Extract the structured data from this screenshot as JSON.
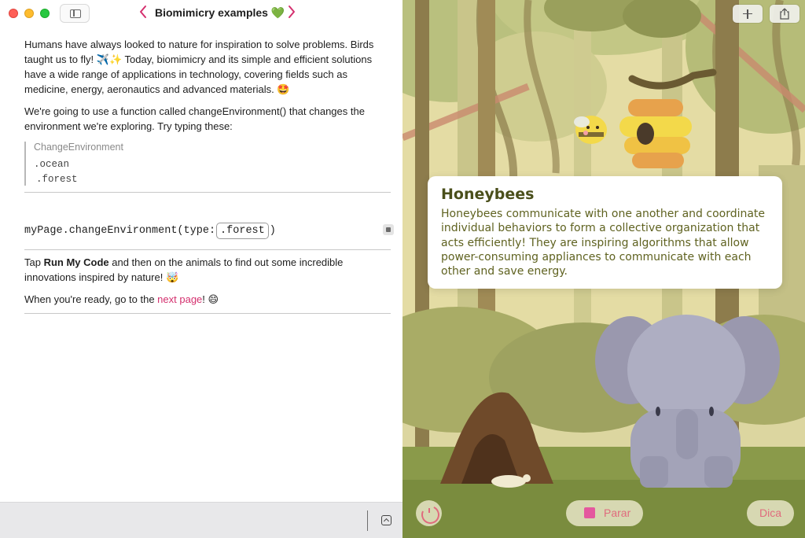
{
  "window": {
    "title": "Biomimicry examples",
    "title_emoji": "💚"
  },
  "left": {
    "paragraph1": {
      "text_a": "Humans have always looked to nature for inspiration to solve problems. Birds taught us to fly! ",
      "emoji_a": "✈️✨",
      "text_b": " Today, biomimicry and its simple and efficient solutions have a wide range of applications in technology, covering fields such as medicine, energy, aeronautics and advanced materials. ",
      "emoji_b": "🤩"
    },
    "paragraph2": "We're going to use a function called changeEnvironment() that changes the environment we're exploring. Try typing these:",
    "quote": {
      "heading": "ChangeEnvironment",
      "option1": ".ocean",
      "option2": ".forest"
    },
    "code": {
      "prefix": "myPage.changeEnvironment(type: ",
      "token": ".forest",
      "suffix": ")"
    },
    "paragraph3": {
      "text_a": "Tap ",
      "bold": "Run My Code",
      "text_b": " and then on the animals to find out some incredible innovations inspired by nature! ",
      "emoji": "🤯"
    },
    "paragraph4": {
      "text_a": "When you're ready, go to the ",
      "link": "next page",
      "text_b": "! ",
      "emoji": "😄"
    }
  },
  "scene": {
    "card": {
      "title": "Honeybees",
      "body": "Honeybees communicate with one another and coordinate individual behaviors to form a collective organization that acts efficiently! They are inspiring algorithms that allow power-consuming appliances to communicate with each other and save energy."
    },
    "controls": {
      "stop_label": "Parar",
      "hint_label": "Dica"
    }
  },
  "colors": {
    "accent": "#d4306e",
    "card_title": "#4a4f1b",
    "card_body": "#5f6220",
    "button_bg": "#d7d8b2",
    "stop_square": "#e4589e"
  }
}
